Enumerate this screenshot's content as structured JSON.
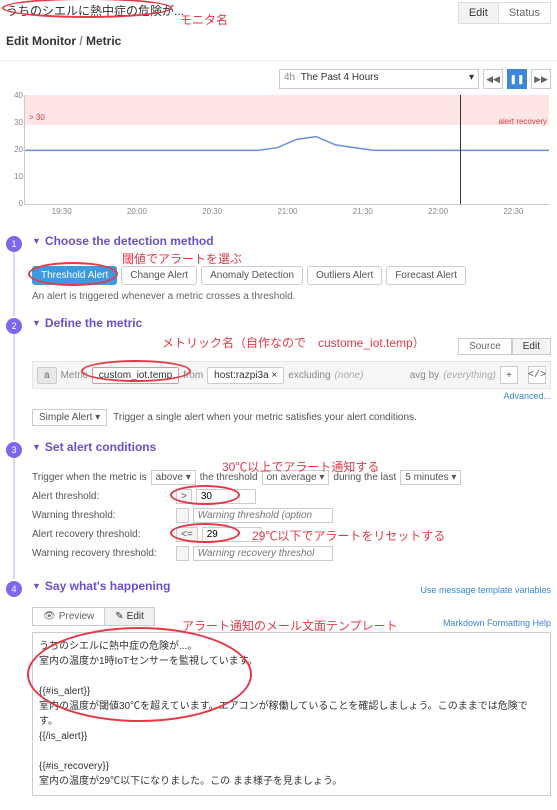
{
  "header": {
    "title": "うちのシエルに熱中症の危険が...",
    "annotation_monitor_name": "モニタ名",
    "tabs": {
      "edit": "Edit",
      "status": "Status"
    }
  },
  "breadcrumb": {
    "a": "Edit Monitor",
    "b": "Metric"
  },
  "chart_controls": {
    "range_prefix": "4h",
    "range_label": "The Past 4 Hours"
  },
  "chart_data": {
    "type": "line",
    "ylim": [
      0,
      40
    ],
    "y_ticks": [
      0,
      10,
      20,
      30,
      40
    ],
    "x_ticks": [
      "19:30",
      "20:00",
      "20:30",
      "21:00",
      "21:30",
      "22:00",
      "22:30"
    ],
    "threshold_label": "> 30",
    "recovery_label": "alert recovery",
    "series": [
      {
        "name": "temp",
        "values": [
          20,
          20,
          20,
          20,
          20,
          20,
          20,
          20,
          20,
          20,
          20,
          20,
          20,
          21,
          24,
          25,
          22,
          21,
          20,
          20,
          20,
          20,
          20,
          20,
          20,
          20,
          20,
          20
        ]
      }
    ]
  },
  "step1": {
    "title": "Choose the detection method",
    "annotation": "閾値でアラートを選ぶ",
    "options": [
      "Threshold Alert",
      "Change Alert",
      "Anomaly Detection",
      "Outliers Alert",
      "Forecast Alert"
    ],
    "desc": "An alert is triggered whenever a metric crosses a threshold."
  },
  "step2": {
    "title": "Define the metric",
    "annotation": "メトリック名（自作なので　custome_iot.temp）",
    "tabs": {
      "source": "Source",
      "edit": "Edit"
    },
    "q": {
      "badge": "a",
      "metric_label": "Metric",
      "metric_value": "custom_iot.temp",
      "from_label": "from",
      "from_value": "host:razpi3a",
      "excl_label": "excluding",
      "excl_value": "(none)",
      "avg_label": "avg by",
      "avg_value": "(everything)"
    },
    "advanced": "Advanced...",
    "simple_alert": "Simple Alert",
    "simple_alert_desc": "Trigger a single alert when your metric satisfies your alert conditions."
  },
  "step3": {
    "title": "Set alert conditions",
    "annotation_top": "30℃以上でアラート通知する",
    "annotation_bottom": "29℃以下でアラートをリセットする",
    "trigger": {
      "prefix": "Trigger when the metric is",
      "op": "above",
      "mid": "the threshold",
      "agg": "on average",
      "during": "during the last",
      "window": "5 minutes"
    },
    "rows": {
      "alert_label": "Alert threshold:",
      "alert_op": ">",
      "alert_val": "30",
      "warn_label": "Warning threshold:",
      "warn_ph": "Warning threshold (option",
      "recov_label": "Alert recovery threshold:",
      "recov_op": "<=",
      "recov_val": "29",
      "wrecov_label": "Warning recovery threshold:",
      "wrecov_ph": "Warning recovery threshol"
    }
  },
  "step4": {
    "title": "Say what's happening",
    "var_link": "Use message template variables",
    "tabs": {
      "preview": "Preview",
      "edit": "Edit"
    },
    "fmt_link": "Markdown Formatting Help",
    "annotation": "アラート通知のメール文面テンプレート",
    "body_lines": [
      "うちのシエルに熱中症の危険が...。",
      "室内の温度か1時IoTセンサーを監視しています。",
      "",
      "{{#is_alert}}",
      "室内の温度が閾値30℃を超えています。エアコンが稼働していることを確認しましょう。このままでは危険です。",
      "{{/is_alert}}",
      "",
      "{{#is_recovery}}",
      "室内の温度が29℃以下になりました。この まま様子を見ましょう。"
    ]
  }
}
